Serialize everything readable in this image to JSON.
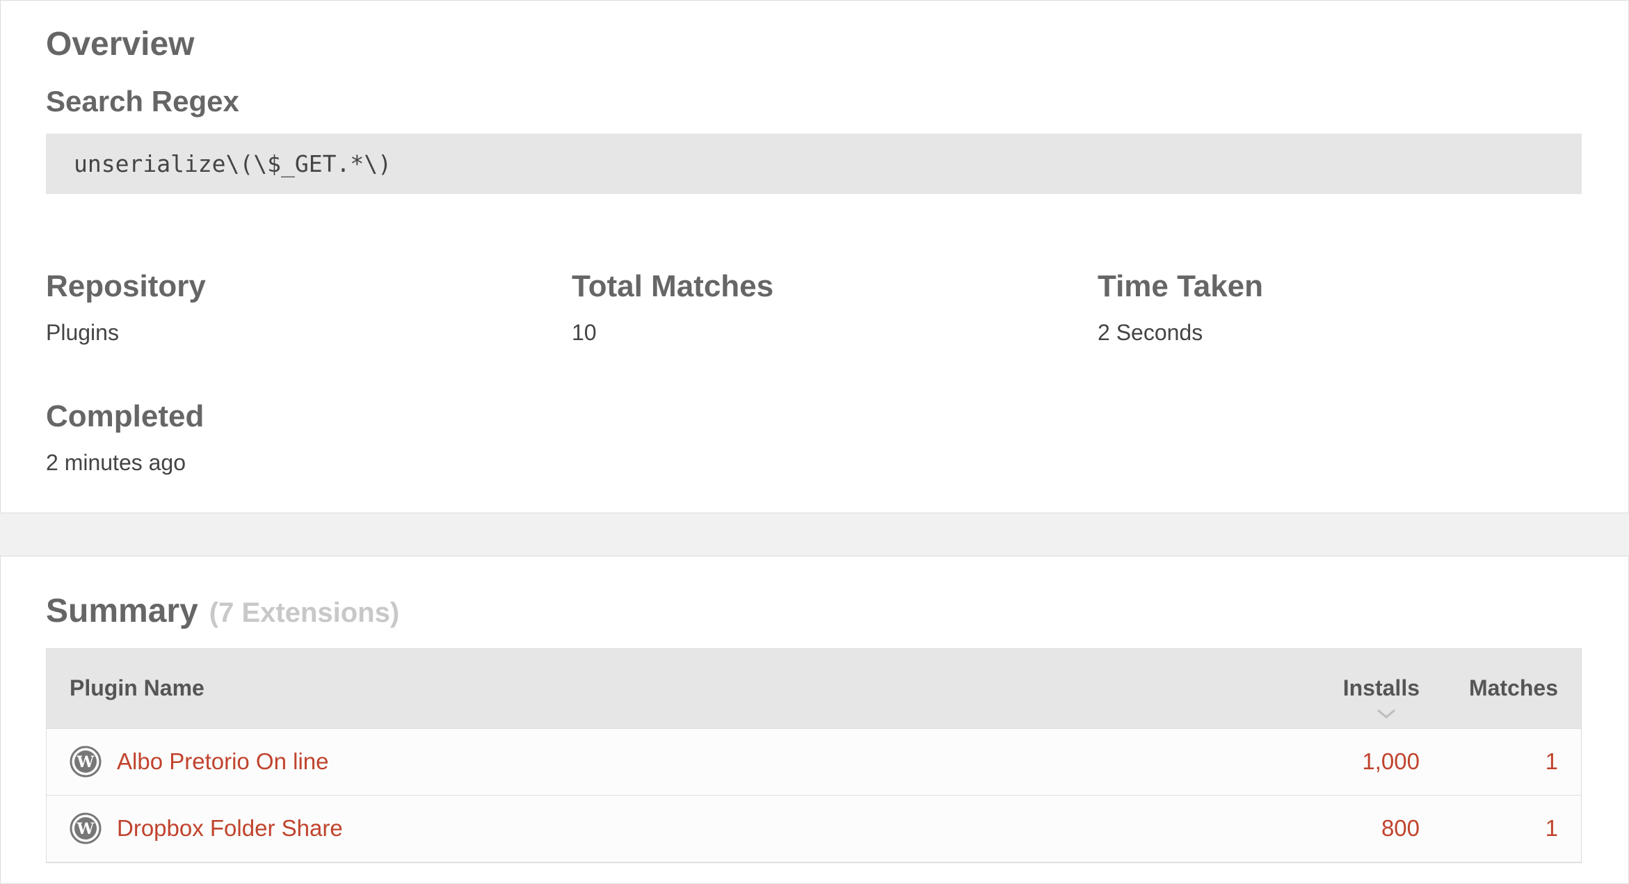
{
  "overview": {
    "title": "Overview",
    "regex_label": "Search Regex",
    "regex_value": "unserialize\\(\\$_GET.*\\)",
    "stats": {
      "repository": {
        "label": "Repository",
        "value": "Plugins"
      },
      "total_matches": {
        "label": "Total Matches",
        "value": "10"
      },
      "time_taken": {
        "label": "Time Taken",
        "value": "2 Seconds"
      },
      "completed": {
        "label": "Completed",
        "value": "2 minutes ago"
      }
    }
  },
  "summary": {
    "title": "Summary",
    "count_label": "(7 Extensions)",
    "columns": {
      "name": "Plugin Name",
      "installs": "Installs",
      "matches": "Matches"
    },
    "sort_icon": "chevron-down-icon",
    "rows": [
      {
        "icon": "wordpress-icon",
        "name": "Albo Pretorio On line",
        "installs": "1,000",
        "matches": "1"
      },
      {
        "icon": "wordpress-icon",
        "name": "Dropbox Folder Share",
        "installs": "800",
        "matches": "1"
      }
    ]
  },
  "colors": {
    "link": "#c0432d",
    "heading": "#666666",
    "muted": "#c8c8c8",
    "panel_bg": "#ffffff",
    "page_bg": "#f1f1f1",
    "code_bg": "#e6e6e6"
  }
}
